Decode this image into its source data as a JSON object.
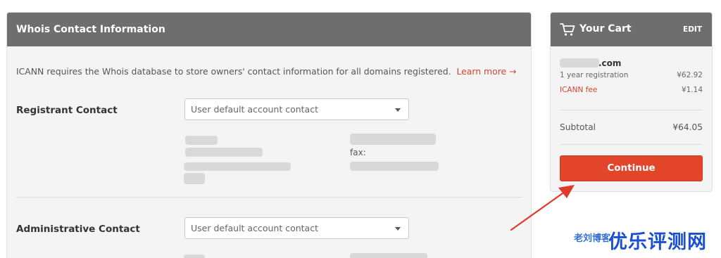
{
  "whois": {
    "title": "Whois Contact Information",
    "intro": "ICANN requires the Whois database to store owners' contact information for all domains registered.",
    "learn_more": "Learn more →",
    "registrant": {
      "label": "Registrant Contact",
      "select_value": "User default account contact"
    },
    "administrative": {
      "label": "Administrative Contact",
      "select_value": "User default account contact"
    },
    "fax_label": "fax:"
  },
  "cart": {
    "title": "Your Cart",
    "edit": "EDIT",
    "domain_suffix": ".com",
    "registration_label": "1 year registration",
    "registration_price": "¥62.92",
    "fee_label": "ICANN fee",
    "fee_price": "¥1.14",
    "subtotal_label": "Subtotal",
    "subtotal_price": "¥64.05",
    "continue": "Continue"
  },
  "watermark": {
    "small": "老刘博客",
    "big": "优乐评测网"
  },
  "colors": {
    "header_bg": "#6e6e6e",
    "accent": "#e2452a",
    "link": "#d0452e",
    "annotation_arrow": "#e03a2a",
    "watermark": "#1a4fcf"
  },
  "icons": {
    "cart": "shopping-cart-icon",
    "dropdown": "chevron-down-icon"
  }
}
